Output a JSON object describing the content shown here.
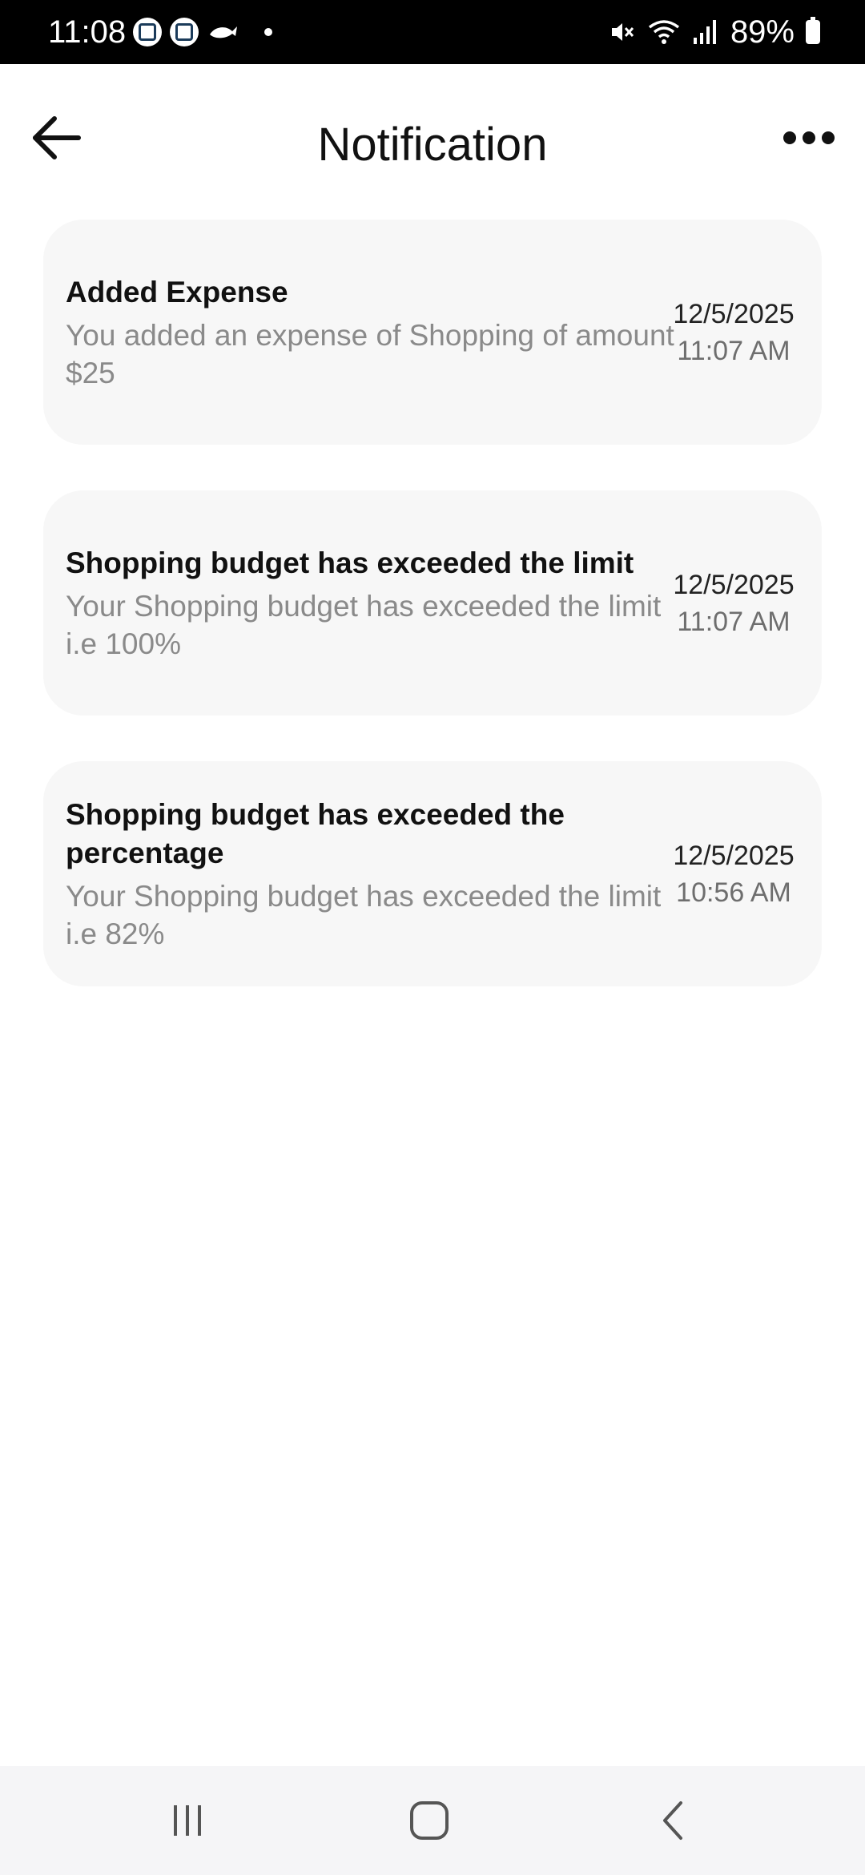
{
  "status_bar": {
    "time": "11:08",
    "battery": "89%",
    "icons": [
      "app-icon",
      "app-icon",
      "fish-icon",
      "dot-icon",
      "mute-icon",
      "wifi-icon",
      "signal-icon",
      "battery-charging-icon"
    ]
  },
  "header": {
    "title": "Notification",
    "back_icon": "arrow-left-icon",
    "more_icon": "more-horizontal-icon"
  },
  "notifications": [
    {
      "title": "Added Expense",
      "body": "You added an expense of Shopping of amount $25",
      "date": "12/5/2025",
      "time": "11:07 AM"
    },
    {
      "title": "Shopping budget has exceeded the limit",
      "body": "Your Shopping budget has exceeded the limit i.e 100%",
      "date": "12/5/2025",
      "time": "11:07 AM"
    },
    {
      "title": "Shopping budget has exceeded the percentage",
      "body": "Your Shopping budget has exceeded the limit i.e 82%",
      "date": "12/5/2025",
      "time": "10:56 AM"
    }
  ],
  "nav_bar": {
    "buttons": [
      "recent-apps-icon",
      "home-icon",
      "back-icon"
    ]
  },
  "colors": {
    "card_background": "#f7f7f7",
    "title_text": "#111111",
    "body_text": "#8a8a8a",
    "status_bar": "#000000",
    "nav_bar": "#f5f5f7"
  }
}
